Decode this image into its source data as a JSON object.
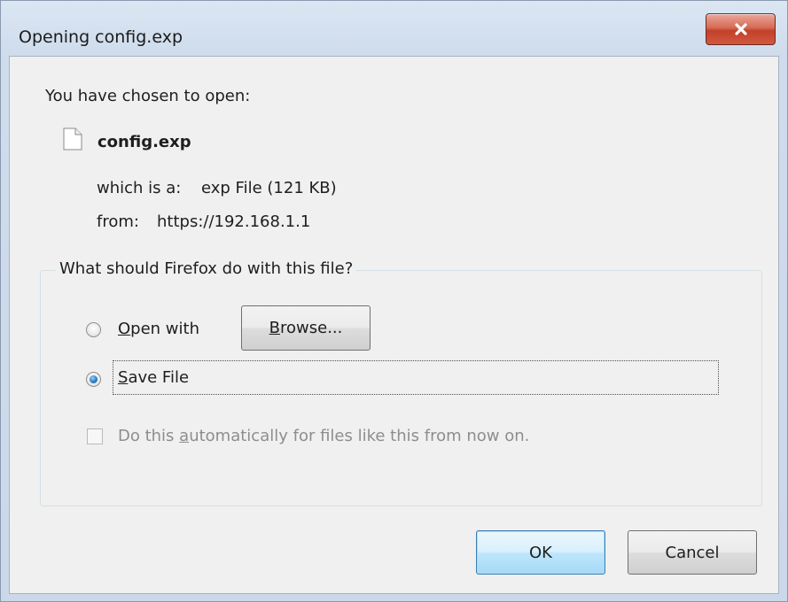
{
  "window": {
    "title": "Opening config.exp",
    "close_label": "x"
  },
  "intro": "You have chosen to open:",
  "file": {
    "name": "config.exp",
    "type_label": "which is a:",
    "type_value": "exp File (121 KB)",
    "from_label": "from:",
    "from_value": "https://192.168.1.1"
  },
  "group": {
    "legend": "What should Firefox do with this file?",
    "open_with": {
      "accel": "O",
      "rest": "pen with",
      "checked": false
    },
    "browse": {
      "accel": "B",
      "rest": "rowse..."
    },
    "save_file": {
      "accel": "S",
      "rest": "ave File",
      "checked": true
    },
    "auto": {
      "before": "Do this ",
      "accel": "a",
      "after": "utomatically for files like this from now on.",
      "checked": false,
      "enabled": false
    }
  },
  "buttons": {
    "ok": "OK",
    "cancel": "Cancel"
  },
  "colors": {
    "title_bar": "#cfdcec",
    "client_bg": "#f0f0f0",
    "close_button": "#c2412a",
    "radio_selected": "#2a7dc4",
    "default_button_border": "#3c7fb1",
    "disabled_text": "#8d8d8d"
  }
}
